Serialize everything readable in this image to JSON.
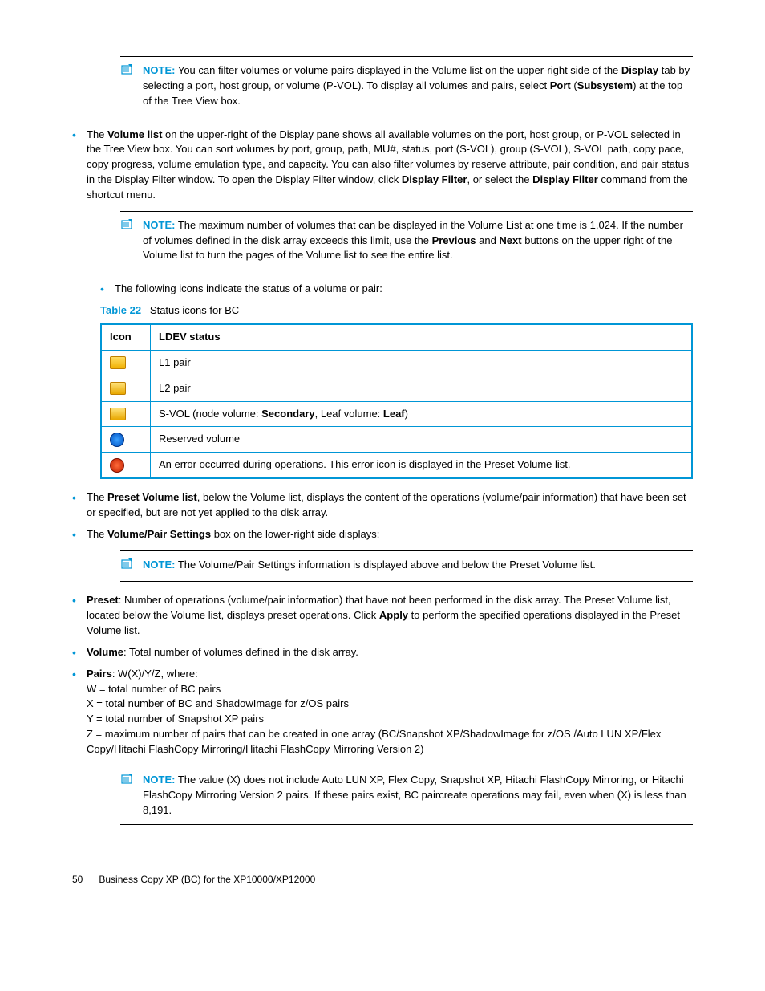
{
  "note1": {
    "label": "NOTE:",
    "text_a": "You can filter volumes or volume pairs displayed in the Volume list on the upper-right side of the ",
    "b_display": "Display",
    "text_b": " tab by selecting a port, host group, or volume (P-VOL). To display all volumes and pairs, select ",
    "b_port": "Port",
    "paren_open": " (",
    "b_subsystem": "Subsystem",
    "text_c": ") at the top of the Tree View box."
  },
  "bullet1": {
    "a": "The ",
    "b_volumelist": "Volume list",
    "b": " on the upper-right of the Display pane shows all available volumes on the port, host group, or P-VOL selected in the Tree View box. You can sort volumes by port, group, path, MU#, status, port (S-VOL), group (S-VOL), S-VOL path, copy pace, copy progress, volume emulation type, and capacity. You can also filter volumes by reserve attribute, pair condition, and pair status in the Display Filter window. To open the Display Filter window, click ",
    "b_df1": "Display Filter",
    "c": ", or select the ",
    "b_df2": "Display Filter",
    "d": " command from the shortcut menu."
  },
  "note2": {
    "label": "NOTE:",
    "a": "The maximum number of volumes that can be displayed in the Volume List at one time is 1,024. If the number of volumes defined in the disk array exceeds this limit, use the ",
    "b_prev": "Previous",
    "b": " and ",
    "b_next": "Next",
    "c": " buttons on the upper right of the Volume list to turn the pages of the Volume list to see the entire list."
  },
  "bullet2": "The following icons indicate the status of a volume or pair:",
  "table": {
    "caption_num": "Table 22",
    "caption_text": "Status icons for BC",
    "h_icon": "Icon",
    "h_status": "LDEV status",
    "rows": [
      {
        "status": "L1 pair"
      },
      {
        "status": "L2 pair"
      },
      {
        "status_a": "S-VOL (node volume: ",
        "b1": "Secondary",
        "mid": ", Leaf volume: ",
        "b2": "Leaf",
        "end": ")"
      },
      {
        "status": "Reserved volume"
      },
      {
        "status": "An error occurred during operations. This error icon is displayed in the Preset Volume list."
      }
    ]
  },
  "bullet3": {
    "a": "The ",
    "b": "Preset Volume list",
    "c": ", below the Volume list, displays the content of the operations (volume/pair information) that have been set or specified, but are not yet applied to the disk array."
  },
  "bullet4": {
    "a": "The ",
    "b": "Volume/Pair Settings",
    "c": " box on the lower-right side displays:"
  },
  "note3": {
    "label": "NOTE:",
    "text": "The Volume/Pair Settings information is displayed above and below the Preset Volume list."
  },
  "sub": {
    "preset": {
      "b": "Preset",
      "t": ": Number of operations (volume/pair information) that have not been performed in the disk array. The Preset Volume list, located below the Volume list, displays preset operations. Click ",
      "apply": "Apply",
      "t2": " to perform the specified operations displayed in the Preset Volume list."
    },
    "volume": {
      "b": "Volume",
      "t": ": Total number of volumes defined in the disk array."
    },
    "pairs": {
      "b": "Pairs",
      "t": ": W(X)/Y/Z, where:",
      "w": "W = total number of BC pairs",
      "x": "X = total number of BC and ShadowImage for z/OS pairs",
      "y": "Y = total number of Snapshot XP pairs",
      "z": "Z = maximum number of pairs that can be created in one array (BC/Snapshot XP/ShadowImage for z/OS /Auto LUN XP/Flex Copy/Hitachi FlashCopy Mirroring/Hitachi FlashCopy Mirroring Version 2)"
    }
  },
  "note4": {
    "label": "NOTE:",
    "text": "The value (X) does not include Auto LUN XP, Flex Copy, Snapshot XP, Hitachi FlashCopy Mirroring, or Hitachi FlashCopy Mirroring Version 2 pairs. If these pairs exist, BC paircreate operations may fail, even when (X) is less than 8,191."
  },
  "footer": {
    "page": "50",
    "title": "Business Copy XP (BC) for the XP10000/XP12000"
  }
}
